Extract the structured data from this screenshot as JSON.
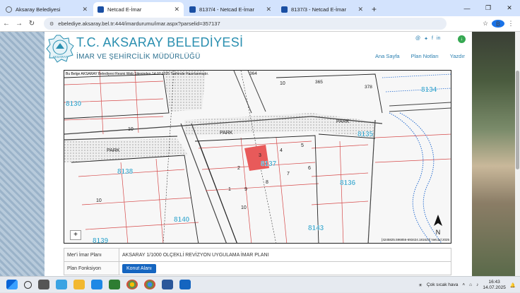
{
  "browser": {
    "tabs": [
      {
        "label": "Aksaray Belediyesi",
        "active": false
      },
      {
        "label": "Netcad E-İmar",
        "active": true
      },
      {
        "label": "8137/4 - Netcad E-İmar",
        "active": false
      },
      {
        "label": "8137/3 - Netcad E-İmar",
        "active": false
      }
    ],
    "url": "ebelediye.aksaray.bel.tr:444/imardurumu/imar.aspx?parselid=357137"
  },
  "site": {
    "title": "T.C. AKSARAY BELEDİYESİ",
    "subtitle": "İMAR VE ŞEHİRCİLİK MÜDÜRLÜĞÜ",
    "logo_text": "AKSARAY",
    "nav": [
      "Ana Sayfa",
      "Plan Notları",
      "Yazdır"
    ]
  },
  "map": {
    "note": "Bu Belge AKSARAY Belediyesi Resmi Web Sitesinden 14.07.2025 Tarihinde Hazırlanmıştır.",
    "scale_text": "[4245825.596856-693424.181624] Netcad 2025",
    "north_label": "N",
    "zoom_label": "+",
    "parcels": [
      "8130",
      "8138",
      "8140",
      "8139",
      "8143",
      "8137",
      "8136",
      "8135",
      "8134"
    ],
    "lots": [
      "1",
      "2",
      "3",
      "4",
      "5",
      "6",
      "7",
      "8",
      "9",
      "10",
      "10",
      "10",
      "10"
    ],
    "park_labels": [
      "PARK",
      "PARK",
      "PARK"
    ],
    "block_codes": [
      "364",
      "365",
      "378"
    ],
    "highlight_parcel": "8137",
    "highlight_color": "#e85a5a"
  },
  "info": {
    "rows": [
      {
        "label": "Mer'i İmar Planı",
        "value": "AKSARAY 1/1000 OLÇEKLİ REVİZYON UYGULAMA İMAR PLANI"
      },
      {
        "label": "Plan Fonksiyon",
        "value": "Konut Alanı"
      }
    ]
  },
  "taskbar": {
    "weather": "Çok sıcak hava",
    "time": "16:43",
    "date": "14.07.2025"
  }
}
